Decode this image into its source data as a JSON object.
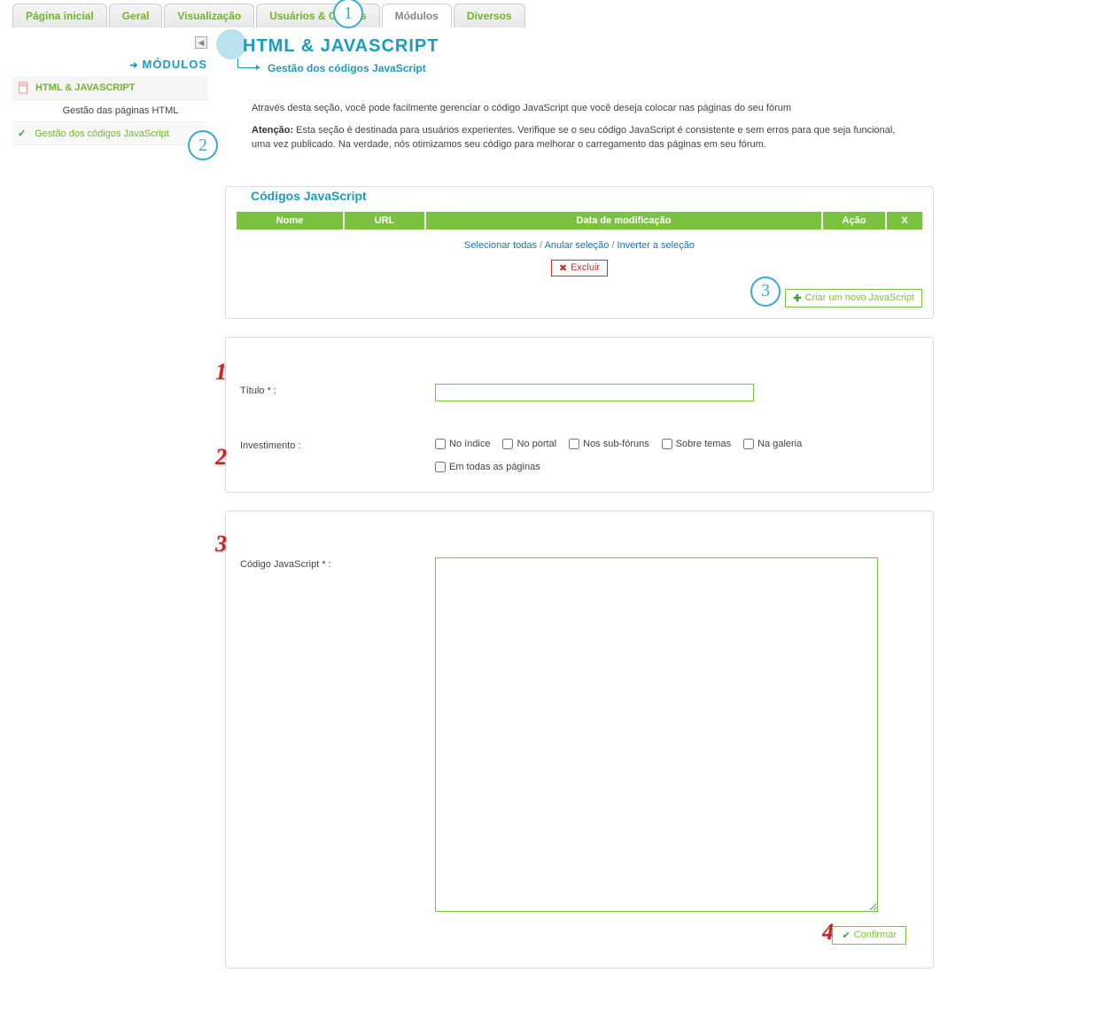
{
  "tabs": [
    {
      "label": "Página inicial"
    },
    {
      "label": "Geral"
    },
    {
      "label": "Visualização"
    },
    {
      "label": "Usuários & Grupos"
    },
    {
      "label": "Módulos",
      "active": true
    },
    {
      "label": "Diversos"
    }
  ],
  "sidebar": {
    "heading": "MÓDULOS",
    "section": "HTML & JAVASCRIPT",
    "items": [
      {
        "label": "Gestão das páginas HTML"
      },
      {
        "label": "Gestão dos códigos JavaScript",
        "active": true
      }
    ]
  },
  "page": {
    "title": "HTML & JAVASCRIPT",
    "subtitle": "Gestão dos códigos JavaScript"
  },
  "intro": {
    "p1": "Através desta seção, você pode facilmente gerenciar o código JavaScript que você deseja colocar nas páginas do seu fórum",
    "warn_label": "Atenção:",
    "p2": " Esta seção é destinada para usuários experientes. Verifique se o seu código JavaScript é consistente e sem erros para que seja funcional, uma vez publicado. Na verdade, nós otimizamos seu código para melhorar o carregamento das páginas em seu fórum."
  },
  "table": {
    "legend": "Códigos JavaScript",
    "headers": {
      "name": "Nome",
      "url": "URL",
      "date": "Data de modificação",
      "action": "Ação",
      "x": "X"
    },
    "select_all": "Selecionar todas",
    "deselect": "Anular seleção",
    "invert": "Inverter a seleção",
    "delete": "Excluir",
    "create": "Criar um novo JavaScript"
  },
  "form": {
    "title_label": "Título * :",
    "invest_label": "Investimento :",
    "checks": {
      "index": "No índice",
      "portal": "No portal",
      "subforums": "Nos sub-fóruns",
      "topics": "Sobre temas",
      "gallery": "Na galeria",
      "allpages": "Em todas as páginas"
    },
    "code_label": "Código JavaScript * :",
    "confirm": "Confirmar"
  },
  "markers": {
    "circle1": "1",
    "circle2": "2",
    "circle3": "3",
    "red1": "1",
    "red2": "2",
    "red3": "3",
    "red4": "4"
  }
}
